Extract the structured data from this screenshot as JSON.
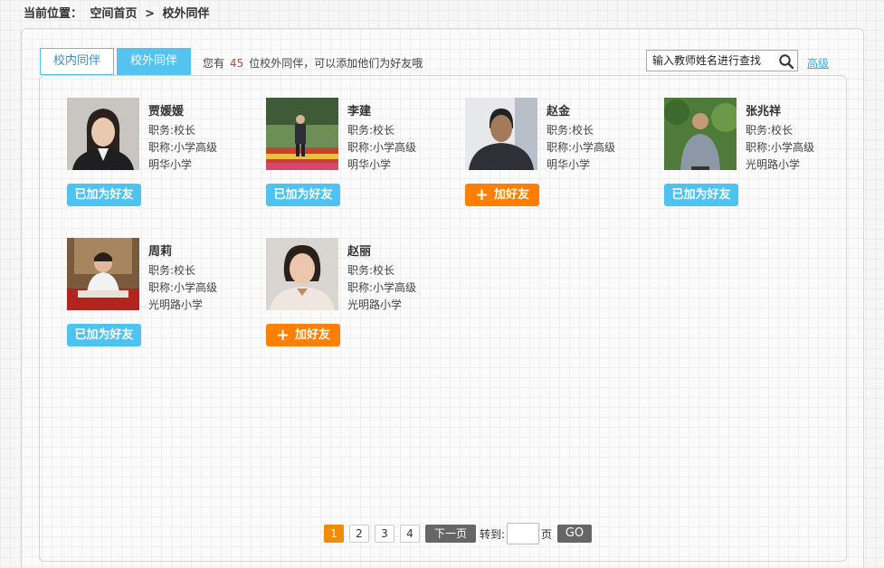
{
  "breadcrumb": {
    "label": "当前位置：",
    "home": "空间首页",
    "separator": ">",
    "current": "校外同伴"
  },
  "tabs": [
    {
      "label": "校内同伴",
      "active": false
    },
    {
      "label": "校外同伴",
      "active": true
    }
  ],
  "summary": {
    "prefix": "您有",
    "count": "45",
    "suffix": "位校外同伴，可以添加他们为好友哦"
  },
  "search": {
    "placeholder": "输入教师姓名进行查找",
    "advanced_link": "高级"
  },
  "colors": {
    "added_button": "#4ec2f0",
    "add_button": "#ff7f00",
    "active_tab": "#55c3f0",
    "active_page": "#f28a0b"
  },
  "peers": [
    {
      "name": "贾媛媛",
      "position": "职务:校长",
      "title": "职称:小学高级",
      "school": "明华小学",
      "button": "已加为好友",
      "status": "added",
      "photo_icon": "person-photo"
    },
    {
      "name": "李建",
      "position": "职务:校长",
      "title": "职称:小学高级",
      "school": "明华小学",
      "button": "已加为好友",
      "status": "added",
      "photo_icon": "person-photo"
    },
    {
      "name": "赵金",
      "position": "职务:校长",
      "title": "职称:小学高级",
      "school": "明华小学",
      "button": "加好友",
      "status": "add",
      "photo_icon": "person-photo"
    },
    {
      "name": "张兆祥",
      "position": "职务:校长",
      "title": "职称:小学高级",
      "school": "光明路小学",
      "button": "已加为好友",
      "status": "added",
      "photo_icon": "person-photo"
    },
    {
      "name": "周莉",
      "position": "职务:校长",
      "title": "职称:小学高级",
      "school": "光明路小学",
      "button": "已加为好友",
      "status": "added",
      "photo_icon": "person-photo"
    },
    {
      "name": "赵丽",
      "position": "职务:校长",
      "title": "职称:小学高级",
      "school": "光明路小学",
      "button": "加好友",
      "status": "add",
      "photo_icon": "person-photo"
    }
  ],
  "pager": {
    "pages": [
      "1",
      "2",
      "3",
      "4"
    ],
    "current_page": "1",
    "next": "下一页",
    "goto_label": "转到:",
    "goto_value": "",
    "page_unit": "页",
    "go": "GO"
  }
}
